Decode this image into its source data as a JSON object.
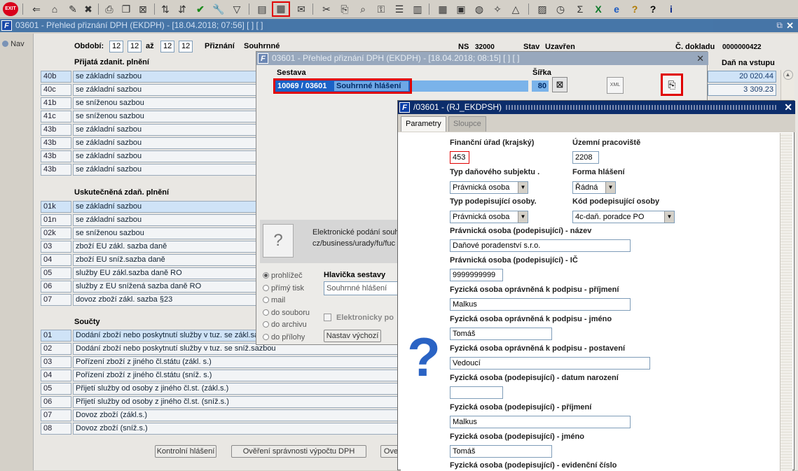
{
  "toolbar": {
    "exit_label": "EXIT"
  },
  "main_window": {
    "title": "03601 - Přehled přiznání DPH (EKDPH) - [18.04.2018; 07:56]  [ ]  [ ]",
    "nav_label": "Nav",
    "obdobi_label": "Období:",
    "obdobi_from_1": "12",
    "obdobi_from_2": "12",
    "az_label": "až",
    "obdobi_to_1": "12",
    "obdobi_to_2": "12",
    "priznani_label": "Přiznání",
    "priznani_value": "Souhrnné",
    "ns_label": "NS",
    "ns_value": "32000",
    "stav_label": "Stav",
    "stav_value": "Uzavřen",
    "cislo_dokladu_label": "Č. dokladu",
    "cislo_dokladu_value": "0000000422",
    "dan_vstup_label": "Daň na vstupu",
    "dan_values": [
      "20 020.44",
      "3 309.23"
    ],
    "section_prijata": "Přijatá zdanit. plnění",
    "prijata_rows": [
      {
        "code": "40b",
        "desc": "se základní sazbou"
      },
      {
        "code": "40c",
        "desc": "se základní sazbou"
      },
      {
        "code": "41b",
        "desc": "se sníženou sazbou"
      },
      {
        "code": "41c",
        "desc": "se sníženou sazbou"
      },
      {
        "code": "43b",
        "desc": "se základní sazbou"
      },
      {
        "code": "43b",
        "desc": "se základní sazbou"
      },
      {
        "code": "43b",
        "desc": "se základní sazbou"
      },
      {
        "code": "43b",
        "desc": "se základní sazbou"
      }
    ],
    "section_uskutecnena": "Uskutečněná zdaň. plnění",
    "uskutecnena_rows": [
      {
        "code": "01k",
        "desc": "se základní sazbou"
      },
      {
        "code": "01n",
        "desc": "se základní sazbou"
      },
      {
        "code": "02k",
        "desc": "se sníženou sazbou"
      },
      {
        "code": "03",
        "desc": "zboží EU zákl. sazba daně"
      },
      {
        "code": "04",
        "desc": "zboží EU sníž.sazba daně"
      },
      {
        "code": "05",
        "desc": "služby EU zákl.sazba daně RO"
      },
      {
        "code": "06",
        "desc": "služby z EU snížená sazba daně RO"
      },
      {
        "code": "07",
        "desc": "dovoz zboží zákl. sazba §23"
      }
    ],
    "section_soucty": "Součty",
    "soucty_rows": [
      {
        "code": "01",
        "desc": "Dodání zboží nebo poskytnutí služby v tuz. se zákl.sazbou"
      },
      {
        "code": "02",
        "desc": "Dodání zboží nebo poskytnutí služby v tuz. se sníž.sazbou"
      },
      {
        "code": "03",
        "desc": "Pořízení zboží z jiného čl.státu (zákl. s.)"
      },
      {
        "code": "04",
        "desc": "Pořízení zboží z jiného čl.státu (sníž. s.)"
      },
      {
        "code": "05",
        "desc": "Přijetí služby od osoby z jiného čl.st. (zákl.s.)"
      },
      {
        "code": "06",
        "desc": "Přijetí služby od osoby z jiného čl.st. (sníž.s.)"
      },
      {
        "code": "07",
        "desc": "Dovoz zboží (zákl.s.)"
      },
      {
        "code": "08",
        "desc": "Dovoz zboží (sníž.s.)"
      }
    ],
    "btn_kontrolni": "Kontrolní hlášení",
    "btn_overeni": "Ověření správnosti výpočtu DPH",
    "btn_ove": "Ove"
  },
  "report_dialog": {
    "title": "03601 - Přehled přiznání DPH (EKDPH) - [18.04.2018; 08:15]  [ ]  [ ]",
    "sestava_label": "Sestava",
    "sestava_code": "10069 / 03601",
    "sestava_name": "Souhrnné hlášení",
    "sirka_label": "Šířka",
    "sirka_value": "80",
    "xml_label": "XML",
    "info_text_1": "Elektronické podání souh",
    "info_text_2": "cz/business/urady/fu/fuc",
    "output_options": [
      "prohlížeč",
      "přímý tisk",
      "mail",
      "do souboru",
      "do archivu",
      "do přílohy"
    ],
    "hlavicka_label": "Hlavička sestavy",
    "hlavicka_value": "Souhrnné hlášení",
    "elektronicky_label": "Elektronicky po",
    "nastav_button": "Nastav výchozí"
  },
  "params_dialog": {
    "title": "/03601 - (RJ_EKDPSH)",
    "tab_parametry": "Parametry",
    "tab_sloupce": "Sloupce",
    "financni_urad_label": "Finanční úřad (krajský)",
    "financni_urad_value": "453",
    "uzemni_label": "Územní pracoviště",
    "uzemni_value": "2208",
    "typ_subjektu_label": "Typ daňového subjektu .",
    "typ_subjektu_value": "Právnická osoba",
    "forma_label": "Forma hlášení",
    "forma_value": "Řádná",
    "typ_podepisujici_label": "Typ podepisující osoby.",
    "typ_podepisujici_value": "Právnická osoba",
    "kod_podepisujici_label": "Kód podepisující osoby",
    "kod_podepisujici_value": "4c-daň. poradce PO",
    "po_nazev_label": "Právnická osoba (podepisující) - název",
    "po_nazev_value": "Daňové poradenství s.r.o.",
    "po_ic_label": "Právnická osoba (podepisující) - IČ",
    "po_ic_value": "9999999999",
    "fo_opr_prijmeni_label": "Fyzická osoba oprávněná k podpisu - příjmení",
    "fo_opr_prijmeni_value": "Malkus",
    "fo_opr_jmeno_label": "Fyzická osoba oprávněná k podpisu - jméno",
    "fo_opr_jmeno_value": "Tomáš",
    "fo_opr_postaveni_label": "Fyzická osoba oprávněná k podpisu - postavení",
    "fo_opr_postaveni_value": "Vedoucí",
    "fo_datum_label": "Fyzická osoba (podepisující) - datum narození",
    "fo_datum_value": "",
    "fo_prijmeni_label": "Fyzická osoba (podepisující) - příjmení",
    "fo_prijmeni_value": "Malkus",
    "fo_jmeno_label": "Fyzická osoba (podepisující) - jméno",
    "fo_jmeno_value": "Tomáš",
    "fo_evidencni_label": "Fyzická osoba (podepisující) - evidenční číslo"
  }
}
